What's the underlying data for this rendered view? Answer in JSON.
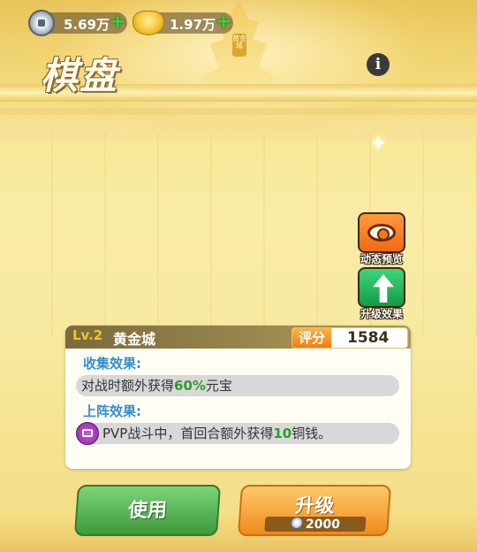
{
  "currency": {
    "copper": {
      "value": "5.69万",
      "icon": "copper-coin-icon"
    },
    "gold": {
      "value": "1.97万",
      "icon": "gold-ingot-icon"
    },
    "plus_label": "+"
  },
  "tower_plaque": "黄金城",
  "title": "棋盘",
  "info_label": "i",
  "side_buttons": {
    "preview": "动态预览",
    "upgrade_effect": "升级效果"
  },
  "panel": {
    "level": "Lv.2",
    "name": "黄金城",
    "score_label": "评分",
    "score": "1584",
    "collect_title": "收集效果:",
    "collect_text_pre": "对战时额外获得",
    "collect_value": "60%",
    "collect_text_post": "元宝",
    "deploy_title": "上阵效果:",
    "deploy_text_pre": "PVP战斗中，首回合额外获得",
    "deploy_value": "10",
    "deploy_text_post": "铜钱。"
  },
  "buttons": {
    "use": "使用",
    "upgrade": "升级",
    "upgrade_cost": "2000"
  },
  "colors": {
    "accent_blue": "#2f8fd3",
    "highlight_green": "#2a9d2a",
    "level_gold": "#f3c227",
    "use_green": "#3c9a3a",
    "upgrade_orange": "#f08a1e"
  }
}
